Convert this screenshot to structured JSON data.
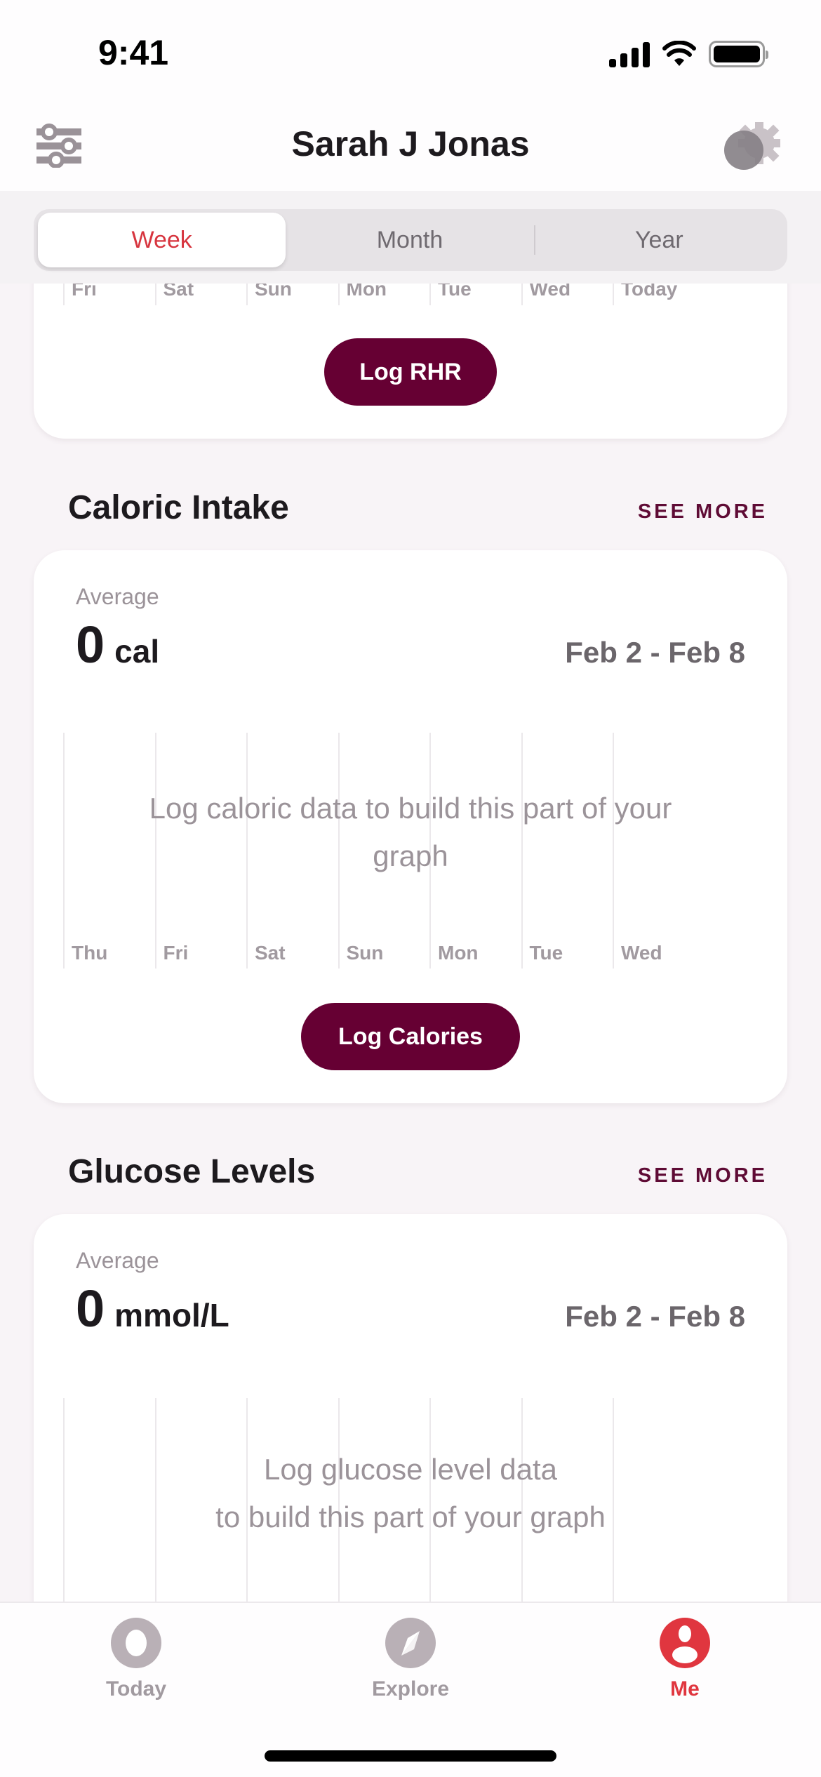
{
  "status_bar": {
    "time": "9:41"
  },
  "header": {
    "title": "Sarah J Jonas",
    "filter_icon": "sliders-icon",
    "settings_icon": "gear-icon"
  },
  "segmented": {
    "items": [
      "Week",
      "Month",
      "Year"
    ],
    "selected": "Week"
  },
  "colors": {
    "accent": "#d7353f",
    "button": "#660033",
    "see_more": "#5f0b35",
    "background": "#f8f4f7"
  },
  "rhr_card": {
    "days": [
      "Fri",
      "Sat",
      "Sun",
      "Mon",
      "Tue",
      "Wed",
      "Today"
    ],
    "button_label": "Log RHR"
  },
  "caloric": {
    "title": "Caloric Intake",
    "see_more": "SEE MORE",
    "average_label": "Average",
    "average_value": "0",
    "unit": "cal",
    "date_range": "Feb 2 - Feb 8",
    "empty_message": "Log caloric data to build this part of your graph",
    "days": [
      "Thu",
      "Fri",
      "Sat",
      "Sun",
      "Mon",
      "Tue",
      "Wed"
    ],
    "button_label": "Log Calories"
  },
  "glucose": {
    "title": "Glucose Levels",
    "see_more": "SEE MORE",
    "average_label": "Average",
    "average_value": "0",
    "unit": "mmol/L",
    "date_range": "Feb 2 - Feb 8",
    "empty_message_line1": "Log glucose level data",
    "empty_message_line2": "to build this part of your graph"
  },
  "tabbar": {
    "items": [
      {
        "label": "Today",
        "icon": "today-ring-icon"
      },
      {
        "label": "Explore",
        "icon": "compass-icon"
      },
      {
        "label": "Me",
        "icon": "profile-icon"
      }
    ],
    "selected": "Me"
  }
}
